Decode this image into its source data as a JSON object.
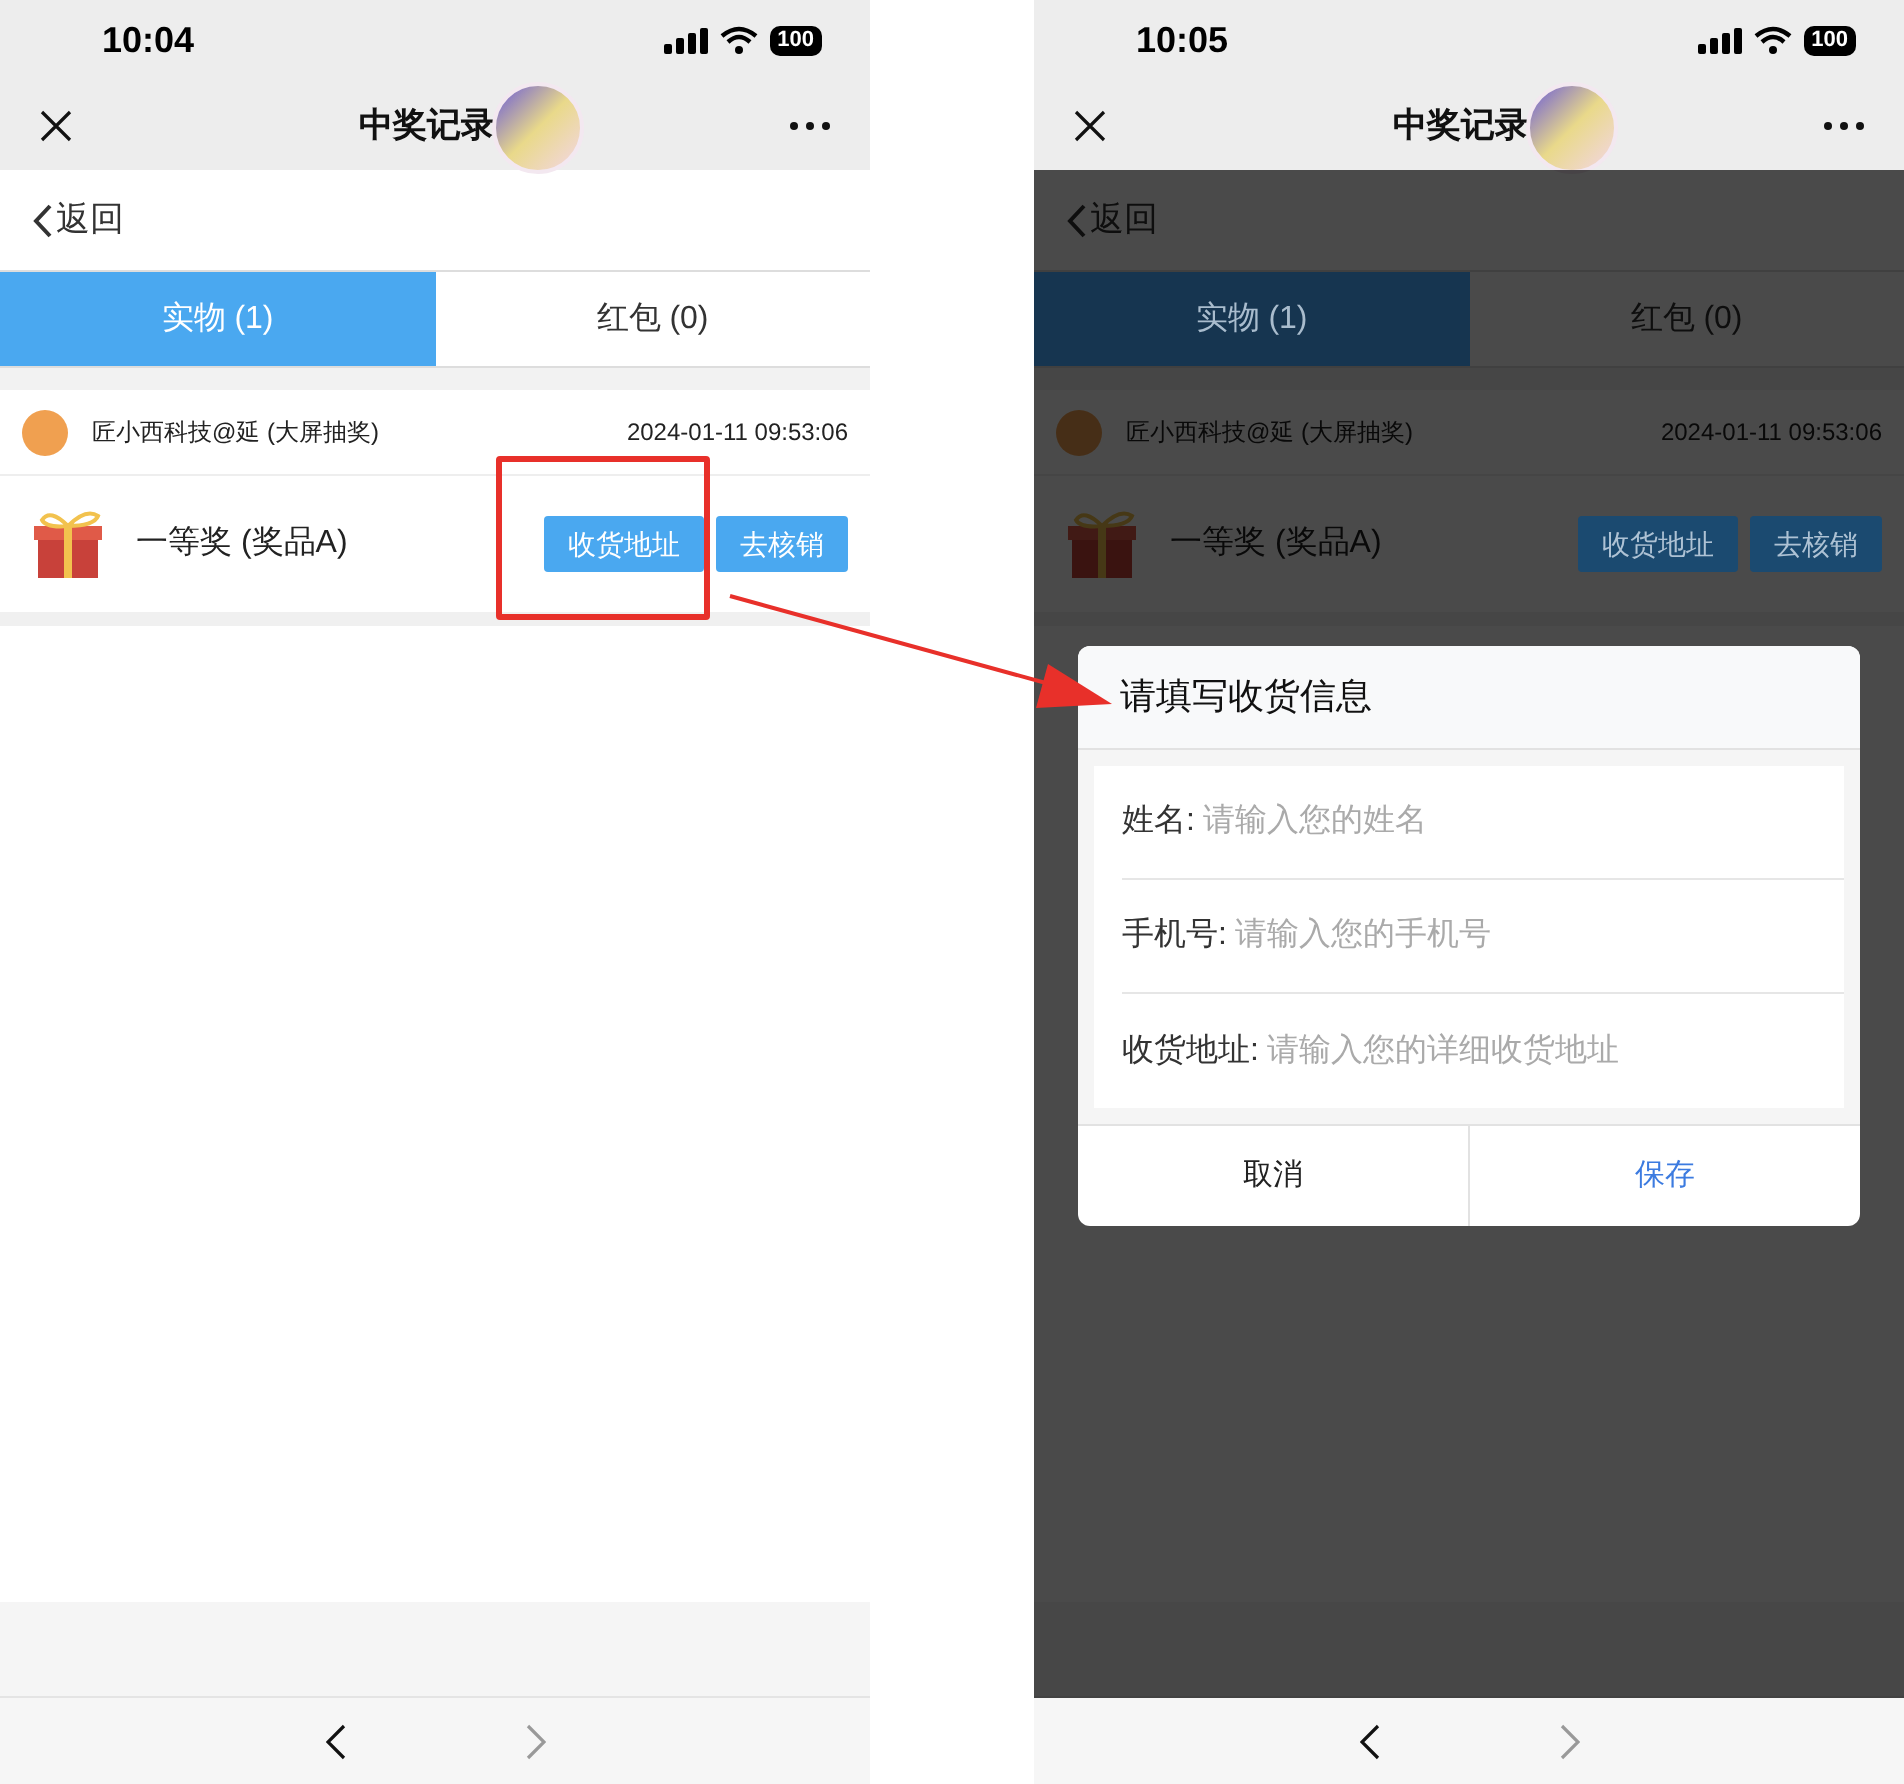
{
  "screens": [
    {
      "time": "10:04",
      "battery": "100",
      "title": "中奖记录",
      "back": "返回",
      "dimmed": false,
      "tabs": [
        {
          "label": "实物 (1)",
          "selected": true
        },
        {
          "label": "红包 (0)",
          "selected": false
        }
      ],
      "record": {
        "source": "匠小西科技@延 (大屏抽奖)",
        "date": "2024-01-11 09:53:06",
        "prize": "一等奖 (奖品A)",
        "actions": [
          "收货地址",
          "去核销"
        ]
      }
    },
    {
      "time": "10:05",
      "battery": "100",
      "title": "中奖记录",
      "back": "返回",
      "dimmed": true,
      "tabs": [
        {
          "label": "实物 (1)",
          "selected": true
        },
        {
          "label": "红包 (0)",
          "selected": false
        }
      ],
      "record": {
        "source": "匠小西科技@延 (大屏抽奖)",
        "date": "2024-01-11 09:53:06",
        "prize": "一等奖 (奖品A)",
        "actions": [
          "收货地址",
          "去核销"
        ]
      },
      "dialog": {
        "title": "请填写收货信息",
        "fields": [
          {
            "label": "姓名:",
            "placeholder": "请输入您的姓名"
          },
          {
            "label": "手机号:",
            "placeholder": "请输入您的手机号"
          },
          {
            "label": "收货地址:",
            "placeholder": "请输入您的详细收货地址"
          }
        ],
        "cancel": "取消",
        "save": "保存"
      }
    }
  ]
}
